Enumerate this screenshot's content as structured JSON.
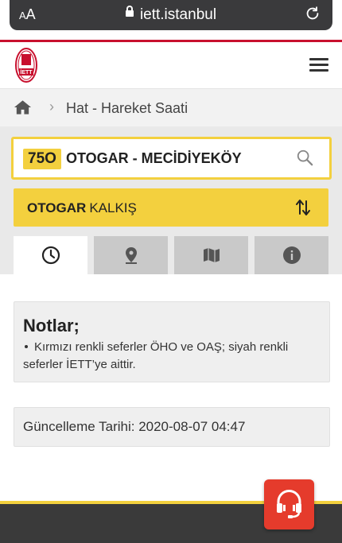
{
  "browser": {
    "text_size_label": "AA",
    "url": "iett.istanbul"
  },
  "header": {
    "logo_text": "İETT"
  },
  "breadcrumb": {
    "current": "Hat - Hareket Saati"
  },
  "route": {
    "line_code": "75O",
    "line_name": "OTOGAR - MECİDİYEKÖY"
  },
  "direction": {
    "stop": "OTOGAR",
    "label": "KALKIŞ"
  },
  "tabs": [
    {
      "icon": "clock-icon",
      "active": true
    },
    {
      "icon": "location-pin-icon",
      "active": false
    },
    {
      "icon": "map-icon",
      "active": false
    },
    {
      "icon": "info-icon",
      "active": false
    }
  ],
  "notes": {
    "title": "Notlar;",
    "items": [
      "Kırmızı renkli seferler ÖHO ve OAŞ; siyah renkli seferler İETT’ye aittir."
    ]
  },
  "update": {
    "text": "Güncelleme Tarihi: 2020-08-07 04:47"
  },
  "colors": {
    "accent_yellow": "#f3d03e",
    "brand_red": "#c8102e",
    "support_red": "#e53b2c",
    "footer_dark": "#3a3a3a"
  }
}
